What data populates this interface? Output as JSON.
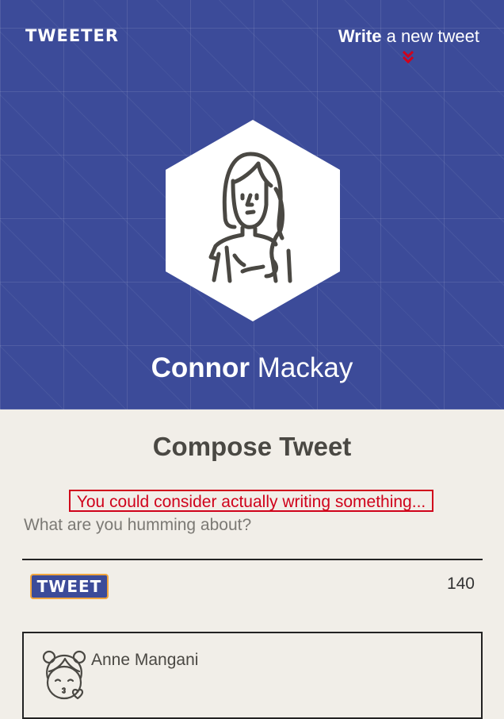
{
  "header": {
    "brand": "TWEETER",
    "write_link_bold": "Write",
    "write_link_rest": " a new tweet"
  },
  "profile": {
    "first_name": "Connor",
    "last_name": " Mackay"
  },
  "compose": {
    "title": "Compose Tweet",
    "error": "You could consider actually writing something...",
    "placeholder": "What are you humming about?",
    "button_label": "TWEET",
    "char_count": "140"
  },
  "tweets": [
    {
      "author": "Anne Mangani"
    }
  ],
  "colors": {
    "header_bg": "#3c4b99",
    "page_bg": "#f1eee8",
    "error": "#d0021b",
    "button_border": "#f0a53f"
  }
}
